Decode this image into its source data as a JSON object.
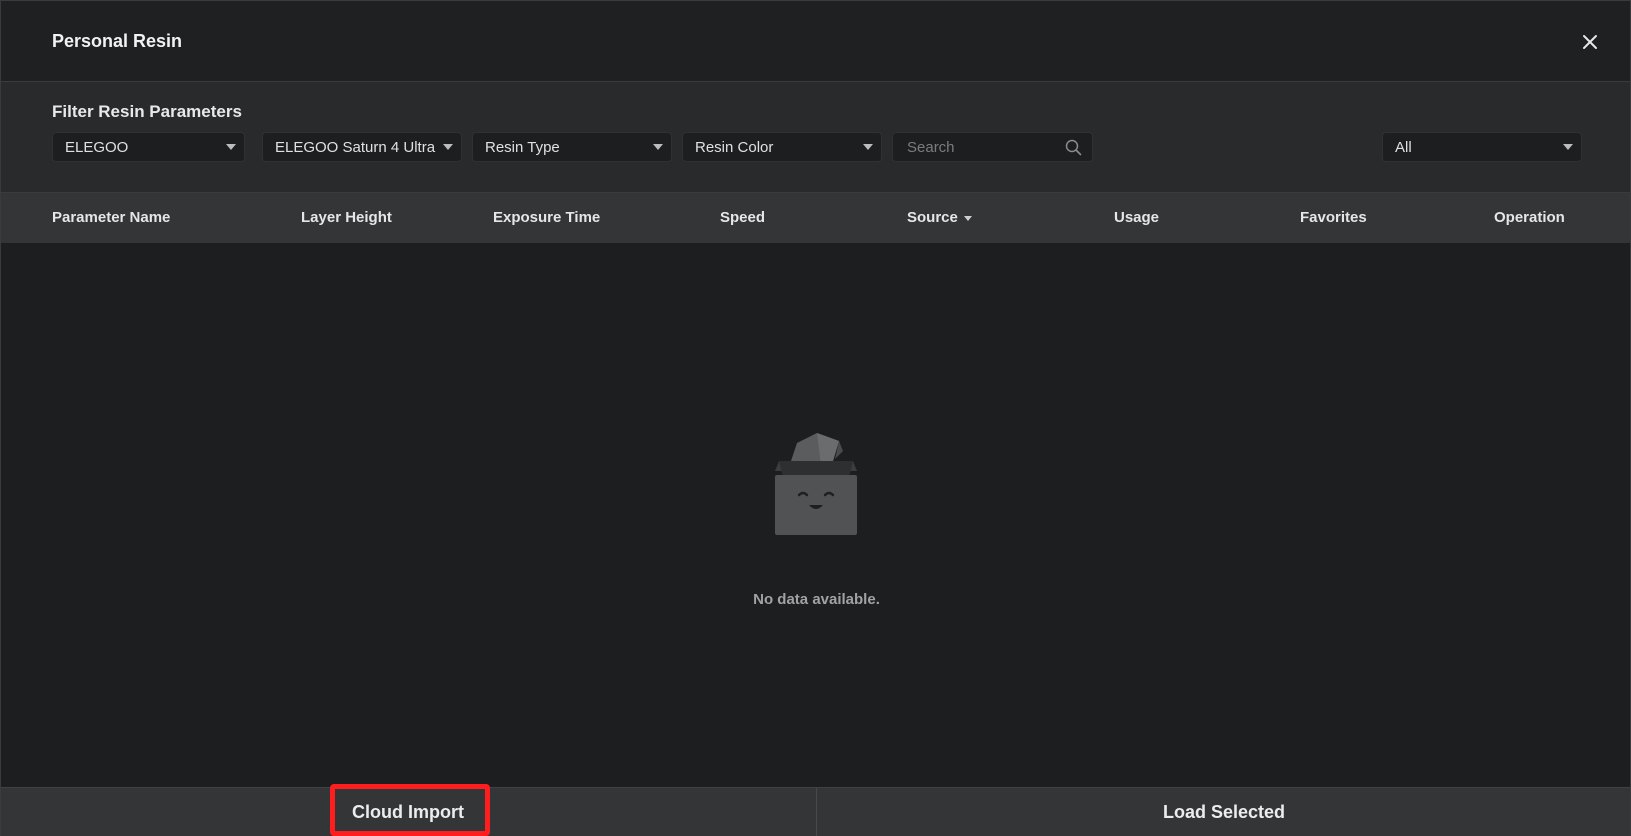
{
  "dialog": {
    "title": "Personal Resin"
  },
  "filters": {
    "section_title": "Filter Resin Parameters",
    "brand": "ELEGOO",
    "printer": "ELEGOO Saturn 4 Ultra",
    "resin_type": "Resin Type",
    "resin_color": "Resin Color",
    "search_placeholder": "Search",
    "scope": "All"
  },
  "table": {
    "columns": [
      "Parameter Name",
      "Layer Height",
      "Exposure Time",
      "Speed",
      "Source",
      "Usage",
      "Favorites",
      "Operation"
    ],
    "rows": [],
    "empty_text": "No data available."
  },
  "footer": {
    "cloud_import": "Cloud Import",
    "load_selected": "Load Selected"
  },
  "colors": {
    "background": "#1f2021",
    "panel": "#282a2c",
    "header": "#333537",
    "highlight": "#ff1d1d"
  },
  "icons": {
    "close": "close-icon",
    "search": "search-icon",
    "dropdown": "chevron-down-icon",
    "empty": "empty-box-icon"
  }
}
